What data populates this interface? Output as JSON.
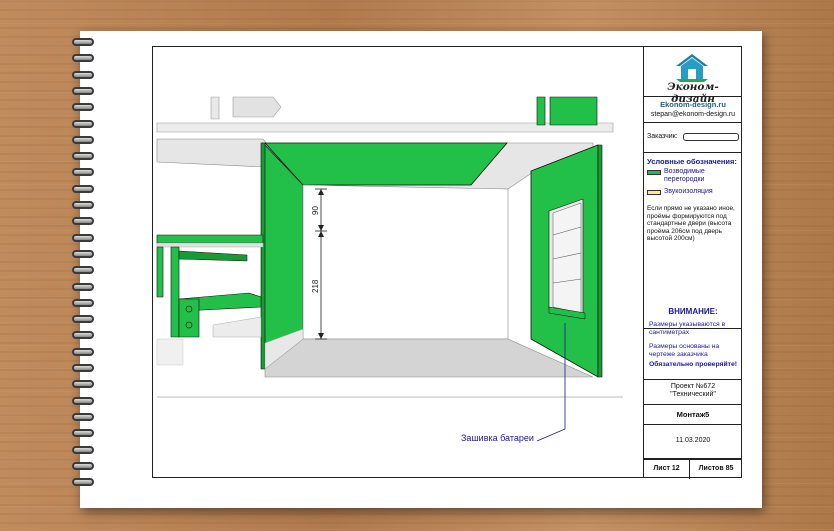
{
  "titleblock": {
    "company": "Эконом-дизайн",
    "site": "Ekonom-design.ru",
    "email": "stepan@ekonom-design.ru",
    "customer_label": "Заказчик:",
    "legend_title": "Условные обозначения:",
    "legend": [
      {
        "label": "Возводимые перегородки",
        "color": "#22c048"
      },
      {
        "label": "Звукоизоляция",
        "color": "#f5f08a"
      }
    ],
    "note": "Если прямо не указано иное, проёмы формируются под стандартные двери (высота проёма 206см под дверь высотой 200см)",
    "attention_title": "ВНИМАНИЕ:",
    "attention_items": [
      "Размеры указываются в сантиметрах",
      "Размеры основаны на чертеже заказчика"
    ],
    "attention_strong": "Обязательно проверяйте!",
    "project_line1": "Проект №672",
    "project_line2": "\"Технический\"",
    "sheet_name": "Монтаж5",
    "date": "11.03.2020",
    "sheet_number": "Лист 12",
    "sheets_total": "Листов 85"
  },
  "drawing": {
    "dimension_top": "90",
    "dimension_bottom": "218",
    "callout": "Зашивка батареи"
  },
  "colors": {
    "partition": "#22c048",
    "partition_dark": "#189a34",
    "soundproof": "#f5f08a",
    "floor": "#d4d4d4",
    "ceiling": "#e4e4e4",
    "callout_line": "#1a1a9a"
  }
}
